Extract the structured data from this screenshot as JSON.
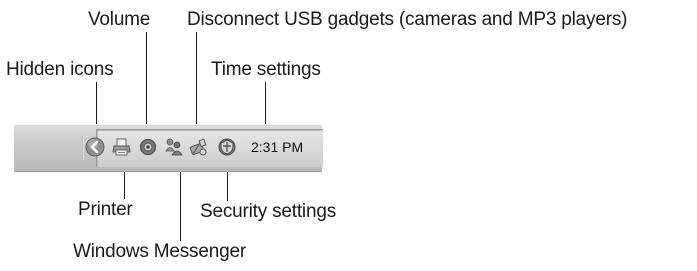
{
  "labels": {
    "volume": "Volume",
    "disconnect_usb": "Disconnect USB gadgets (cameras and MP3 players)",
    "hidden_icons": "Hidden icons",
    "time_settings": "Time settings",
    "printer": "Printer",
    "security_settings": "Security settings",
    "windows_messenger": "Windows Messenger"
  },
  "taskbar": {
    "clock": "2:31 PM"
  },
  "icons": [
    "chevron-left-icon",
    "printer-icon",
    "volume-icon",
    "messenger-icon",
    "usb-disconnect-icon",
    "security-shield-icon"
  ]
}
